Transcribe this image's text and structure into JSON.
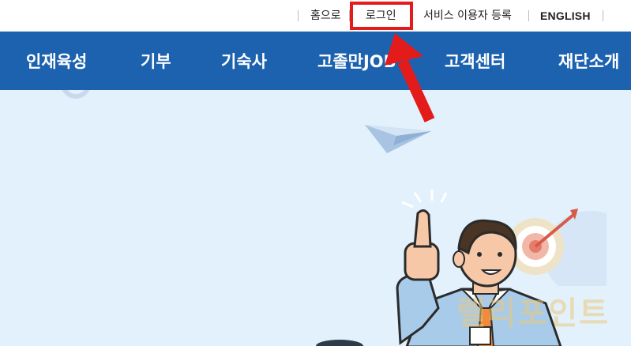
{
  "top_links": {
    "home": "홈으로",
    "login": "로그인",
    "register": "서비스 이용자 등록",
    "english": "ENGLISH"
  },
  "nav": {
    "items": [
      {
        "label": "인재육성"
      },
      {
        "label": "기부"
      },
      {
        "label": "기숙사"
      },
      {
        "label": "고졸만JOB"
      },
      {
        "label": "고객센터"
      },
      {
        "label": "재단소개"
      }
    ]
  },
  "watermark": "렐리포인트",
  "colors": {
    "nav_bg": "#1c62ae",
    "hero_bg": "#e3f1fc",
    "highlight": "#e31b1b"
  }
}
